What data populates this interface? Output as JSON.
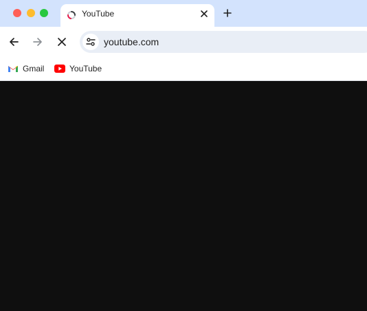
{
  "window": {
    "controls": [
      "close",
      "minimize",
      "maximize"
    ]
  },
  "tab": {
    "title": "YouTube",
    "icon": "loading-spinner-icon"
  },
  "toolbar": {
    "url": "youtube.com",
    "loading": true
  },
  "bookmarks": [
    {
      "label": "Gmail",
      "icon": "gmail-icon"
    },
    {
      "label": "YouTube",
      "icon": "youtube-icon"
    }
  ],
  "colors": {
    "tab_strip": "#d3e3fd",
    "omnibox": "#e9eef6",
    "page_background": "#0f0f0f",
    "youtube_red": "#ff0000"
  }
}
